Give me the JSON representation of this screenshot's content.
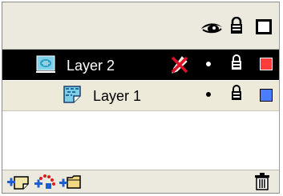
{
  "panel": {
    "header": {
      "icons": [
        "eye-icon",
        "lock-icon",
        "outline-square-icon"
      ]
    },
    "layers": [
      {
        "label": "Layer 2",
        "selected": true,
        "type": "guide",
        "edit_icon": "pencil-no-edit-icon",
        "visible": true,
        "locked": false,
        "outline_color": "#ff3b3b"
      },
      {
        "label": "Layer 1",
        "selected": false,
        "type": "guided",
        "visible": true,
        "locked": false,
        "outline_color": "#4a7dff"
      }
    ],
    "footer": {
      "buttons": [
        "add-layer-icon",
        "add-motion-guide-icon",
        "add-folder-icon",
        "delete-layer-icon"
      ]
    }
  },
  "colors": {
    "panel_bg": "#eceade",
    "selected_row_bg": "#000000",
    "row_bg": "#eeeada"
  }
}
